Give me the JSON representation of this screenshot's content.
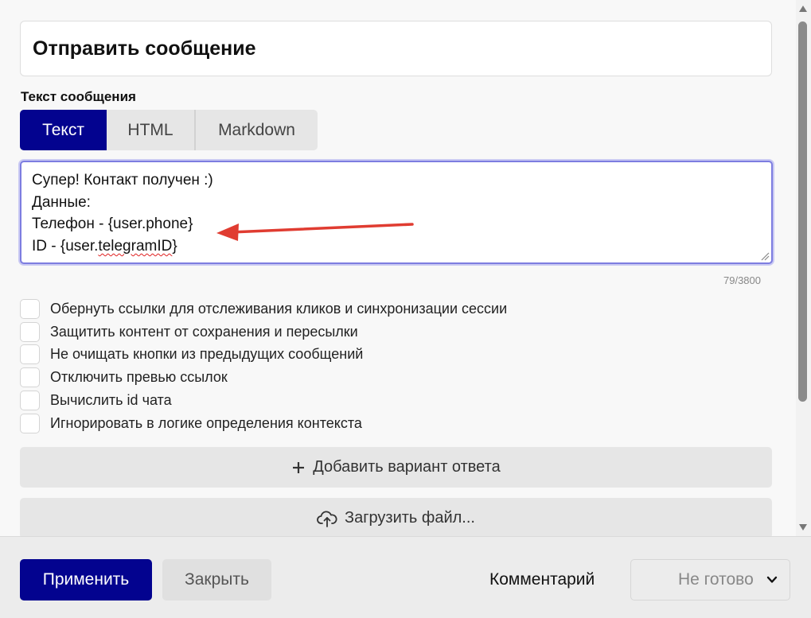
{
  "page": {
    "title": "Отправить сообщение",
    "section_label": "Текст сообщения"
  },
  "tabs": [
    {
      "label": "Текст",
      "active": true
    },
    {
      "label": "HTML",
      "active": false
    },
    {
      "label": "Markdown",
      "active": false
    }
  ],
  "message": {
    "lines": [
      "Супер! Контакт получен :)",
      "Данные:",
      "Телефон - {user.phone}",
      "ID - {user.telegramID}"
    ],
    "line4_prefix": "ID - {user.",
    "line4_misspelled": "telegramID",
    "line4_suffix": "}",
    "counter": "79/3800"
  },
  "options": [
    {
      "label": "Обернуть ссылки для отслеживания кликов и синхронизации сессии",
      "checked": false
    },
    {
      "label": "Защитить контент от сохранения и пересылки",
      "checked": false
    },
    {
      "label": "Не очищать кнопки из предыдущих сообщений",
      "checked": false
    },
    {
      "label": "Отключить превью ссылок",
      "checked": false
    },
    {
      "label": "Вычислить id чата",
      "checked": false
    },
    {
      "label": "Игнорировать в логике определения контекста",
      "checked": false
    }
  ],
  "actions": {
    "add_answer": {
      "icon": "plus-icon",
      "label": "Добавить вариант ответа"
    },
    "upload_file": {
      "icon": "cloud-upload-icon",
      "label": "Загрузить файл..."
    }
  },
  "footer": {
    "apply_label": "Применить",
    "close_label": "Закрыть",
    "comment_label": "Комментарий",
    "status_value": "Не готово"
  },
  "colors": {
    "primary": "#03038f",
    "annotation_arrow": "#e03c31",
    "focus_border": "#7d7de0"
  }
}
